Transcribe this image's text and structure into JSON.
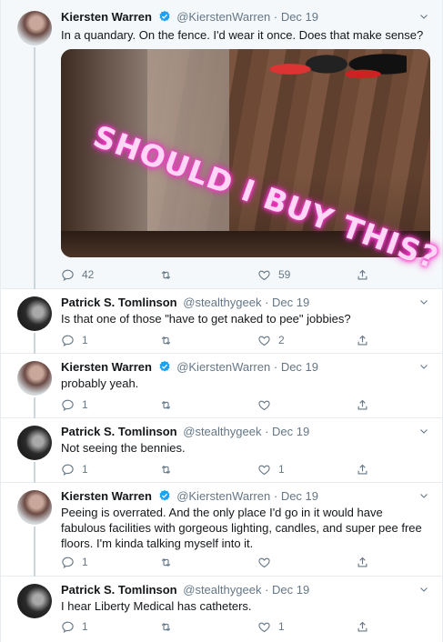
{
  "tweets": [
    {
      "name": "Kiersten Warren",
      "handle": "@KierstenWarren",
      "date": "Dec 19",
      "text": "In a quandary. On the fence. I'd wear it once. Does that make sense?",
      "media_overlay": "SHOULD I BUY THIS?",
      "replies": "42",
      "retweets": "",
      "likes": "59"
    },
    {
      "name": "Patrick S. Tomlinson",
      "handle": "@stealthygeek",
      "date": "Dec 19",
      "text": "Is that one of those \"have to get naked to pee\" jobbies?",
      "replies": "1",
      "retweets": "",
      "likes": "2"
    },
    {
      "name": "Kiersten Warren",
      "handle": "@KierstenWarren",
      "date": "Dec 19",
      "text": "probably yeah.",
      "replies": "1",
      "retweets": "",
      "likes": ""
    },
    {
      "name": "Patrick S. Tomlinson",
      "handle": "@stealthygeek",
      "date": "Dec 19",
      "text": "Not seeing the bennies.",
      "replies": "1",
      "retweets": "",
      "likes": "1"
    },
    {
      "name": "Kiersten Warren",
      "handle": "@KierstenWarren",
      "date": "Dec 19",
      "text": "Peeing is overrated. And the only place I'd go in it would have fabulous facilities with gorgeous lighting, candles, and super pee free floors. I'm kinda talking myself into it.",
      "replies": "1",
      "retweets": "",
      "likes": ""
    },
    {
      "name": "Patrick S. Tomlinson",
      "handle": "@stealthygeek",
      "date": "Dec 19",
      "text": "I hear Liberty Medical has catheters.",
      "replies": "1",
      "retweets": "",
      "likes": "1"
    }
  ],
  "separator": "·",
  "icons": {
    "verified": "verified-badge-icon",
    "caret": "chevron-down-icon",
    "reply": "reply-icon",
    "retweet": "retweet-icon",
    "like": "heart-icon",
    "share": "share-icon"
  },
  "colors": {
    "verified": "#1da1f2",
    "muted": "#657786",
    "thread": "#ccd6dd",
    "highlight_bg": "#f5f8fa"
  }
}
